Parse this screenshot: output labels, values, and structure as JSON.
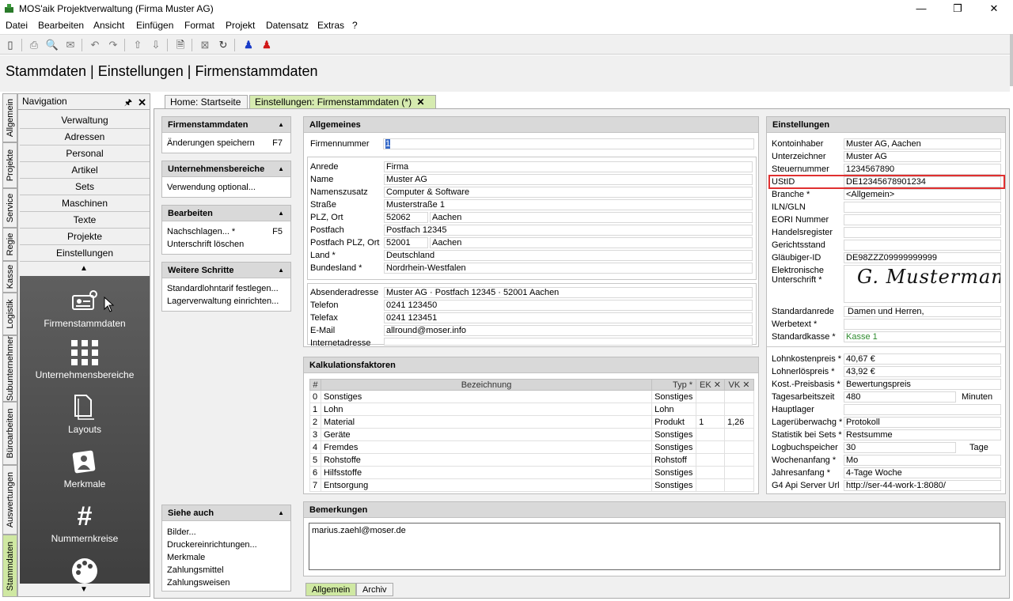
{
  "window": {
    "title": "MOS'aik Projektverwaltung (Firma Muster AG)",
    "min": "—",
    "max": "❐",
    "close": "✕"
  },
  "menu": [
    "Datei",
    "Bearbeiten",
    "Ansicht",
    "Einfügen",
    "Format",
    "Projekt",
    "Datensatz",
    "Extras",
    "?"
  ],
  "header": {
    "title": "Stammdaten | Einstellungen | Firmenstammdaten"
  },
  "navigation": {
    "title": "Navigation",
    "pin": "🖈",
    "close": "✕",
    "items": [
      "Verwaltung",
      "Adressen",
      "Personal",
      "Artikel",
      "Sets",
      "Maschinen",
      "Texte",
      "Projekte",
      "Einstellungen"
    ],
    "up": "▲",
    "down": "▼",
    "tiles": [
      {
        "label": "Firmenstammdaten",
        "icon": "id-card-gear-icon"
      },
      {
        "label": "Unternehmensbereiche",
        "icon": "grid-icon"
      },
      {
        "label": "Layouts",
        "icon": "documents-icon"
      },
      {
        "label": "Merkmale",
        "icon": "photo-icon"
      },
      {
        "label": "Nummernkreise",
        "icon": "hash-icon"
      },
      {
        "label": "",
        "icon": "palette-icon"
      }
    ]
  },
  "left_tabs": [
    "Allgemein",
    "Projekte",
    "Service",
    "Regie",
    "Kasse",
    "Logistik",
    "Subunternehmer",
    "Büroarbeiten",
    "Auswertungen",
    "Stammdaten"
  ],
  "doc_tabs": [
    {
      "label": "Home: Startseite"
    },
    {
      "label": "Einstellungen: Firmenstammdaten (*)",
      "close": "✕"
    }
  ],
  "side_panels": {
    "firmenstammdaten": {
      "title": "Firmenstammdaten",
      "items": [
        {
          "label": "Änderungen speichern",
          "key": "F7"
        }
      ]
    },
    "unternehmensbereiche": {
      "title": "Unternehmensbereiche",
      "items": [
        {
          "label": "Verwendung optional..."
        }
      ]
    },
    "bearbeiten": {
      "title": "Bearbeiten",
      "items": [
        {
          "label": "Nachschlagen... *",
          "key": "F5"
        },
        {
          "label": "Unterschrift löschen"
        }
      ]
    },
    "weitere": {
      "title": "Weitere Schritte",
      "items": [
        {
          "label": "Standardlohntarif festlegen..."
        },
        {
          "label": "Lagerverwaltung einrichten..."
        }
      ]
    },
    "siehe": {
      "title": "Siehe auch",
      "items": [
        "Bilder...",
        "Druckereinrichtungen...",
        "Merkmale",
        "Zahlungsmittel",
        "Zahlungsweisen"
      ]
    }
  },
  "allgemeines": {
    "title": "Allgemeines",
    "firmennummer": {
      "label": "Firmennummer",
      "value": "1"
    },
    "anrede": {
      "label": "Anrede",
      "value": "Firma"
    },
    "name": {
      "label": "Name",
      "value": "Muster AG"
    },
    "namenszusatz": {
      "label": "Namenszusatz",
      "value": "Computer & Software"
    },
    "strasse": {
      "label": "Straße",
      "value": "Musterstraße 1"
    },
    "plz_ort": {
      "label": "PLZ, Ort",
      "plz": "52062",
      "ort": "Aachen"
    },
    "postfach": {
      "label": "Postfach",
      "value": "Postfach 12345"
    },
    "postfach_plz": {
      "label": "Postfach PLZ, Ort",
      "plz": "52001",
      "ort": "Aachen"
    },
    "land": {
      "label": "Land *",
      "value": "Deutschland"
    },
    "bundesland": {
      "label": "Bundesland *",
      "value": "Nordrhein-Westfalen"
    },
    "absender": {
      "label": "Absenderadresse",
      "value": "Muster AG · Postfach 12345 · 52001 Aachen"
    },
    "telefon": {
      "label": "Telefon",
      "value": "0241 123450"
    },
    "telefax": {
      "label": "Telefax",
      "value": "0241 123451"
    },
    "email": {
      "label": "E-Mail",
      "value": "allround@moser.info"
    },
    "internet": {
      "label": "Internetadresse",
      "value": ""
    }
  },
  "kalkulation": {
    "title": "Kalkulationsfaktoren",
    "columns": [
      "#",
      "Bezeichnung",
      "Typ *",
      "EK ✕",
      "VK ✕"
    ],
    "rows": [
      {
        "n": "0",
        "bez": "Sonstiges",
        "typ": "Sonstiges",
        "ek": "",
        "vk": ""
      },
      {
        "n": "1",
        "bez": "Lohn",
        "typ": "Lohn",
        "ek": "",
        "vk": ""
      },
      {
        "n": "2",
        "bez": "Material",
        "typ": "Produkt",
        "ek": "1",
        "vk": "1,26"
      },
      {
        "n": "3",
        "bez": "Geräte",
        "typ": "Sonstiges",
        "ek": "",
        "vk": ""
      },
      {
        "n": "4",
        "bez": "Fremdes",
        "typ": "Sonstiges",
        "ek": "",
        "vk": ""
      },
      {
        "n": "5",
        "bez": "Rohstoffe",
        "typ": "Rohstoff",
        "ek": "",
        "vk": ""
      },
      {
        "n": "6",
        "bez": "Hilfsstoffe",
        "typ": "Sonstiges",
        "ek": "",
        "vk": ""
      },
      {
        "n": "7",
        "bez": "Entsorgung",
        "typ": "Sonstiges",
        "ek": "",
        "vk": ""
      }
    ]
  },
  "einstellungen": {
    "title": "Einstellungen",
    "kontoinhaber": {
      "label": "Kontoinhaber",
      "value": "Muster AG, Aachen"
    },
    "unterzeichner": {
      "label": "Unterzeichner",
      "value": "Muster AG"
    },
    "steuernummer": {
      "label": "Steuernummer",
      "value": "1234567890"
    },
    "ustid": {
      "label": "UStID",
      "value": "DE12345678901234"
    },
    "branche": {
      "label": "Branche *",
      "value": "<Allgemein>"
    },
    "iln": {
      "label": "ILN/GLN",
      "value": ""
    },
    "eori": {
      "label": "EORI Nummer",
      "value": ""
    },
    "handelsregister": {
      "label": "Handelsregister",
      "value": ""
    },
    "gerichtsstand": {
      "label": "Gerichtsstand",
      "value": ""
    },
    "glaeubiger": {
      "label": "Gläubiger-ID",
      "value": "DE98ZZZ09999999999"
    },
    "unterschrift": {
      "label1": "Elektronische",
      "label2": "Unterschrift *",
      "signature": "G. Mustermann"
    },
    "standardanrede": {
      "label": "Standardanrede",
      "value": "Damen und Herren,"
    },
    "werbetext": {
      "label": "Werbetext *",
      "value": ""
    },
    "standardkasse": {
      "label": "Standardkasse *",
      "value": "Kasse 1",
      "color": "#2e8b2e"
    },
    "lohnkostenpreis": {
      "label": "Lohnkostenpreis *",
      "value": "40,67 €"
    },
    "lohnerloespreis": {
      "label": "Lohnerlöspreis *",
      "value": "43,92 €"
    },
    "preisbasis": {
      "label": "Kost.-Preisbasis *",
      "value": "Bewertungspreis"
    },
    "tagesarbeitszeit": {
      "label": "Tagesarbeitszeit",
      "value": "480",
      "unit": "Minuten"
    },
    "hauptlager": {
      "label": "Hauptlager",
      "value": ""
    },
    "lagerueberwachung": {
      "label": "Lagerüberwachg *",
      "value": "Protokoll"
    },
    "statistik": {
      "label": "Statistik bei Sets *",
      "value": "Restsumme"
    },
    "logbuch": {
      "label": "Logbuchspeicher",
      "value": "30",
      "unit": "Tage"
    },
    "wochenanfang": {
      "label": "Wochenanfang *",
      "value": "Mo"
    },
    "jahresanfang": {
      "label": "Jahresanfang *",
      "value": "4-Tage Woche"
    },
    "g4api": {
      "label": "G4 Api Server Url",
      "value": "http://ser-44-work-1:8080/"
    }
  },
  "bemerkungen": {
    "title": "Bemerkungen",
    "text": "marius.zaehl@moser.de"
  },
  "bottom_tabs": [
    "Allgemein",
    "Archiv"
  ],
  "colors": {
    "accent_green": "#d6ebb0",
    "highlight_red": "#e03030"
  }
}
